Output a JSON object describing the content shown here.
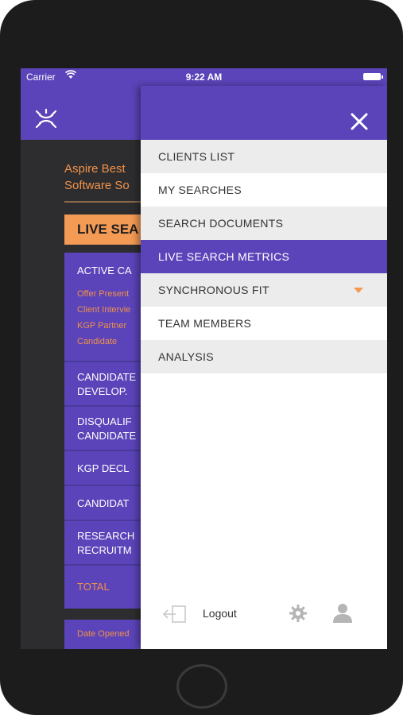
{
  "status_bar": {
    "carrier": "Carrier",
    "time": "9:22 AM"
  },
  "app": {
    "company_line1": "Aspire Best",
    "company_line2": "Software So",
    "tab_label": "LIVE SEA",
    "metrics": [
      {
        "title": "ACTIVE CA",
        "subs": [
          "Offer Present",
          "Client Intervie",
          "KGP Partner",
          "Candidate"
        ]
      },
      {
        "title_line1": "CANDIDATE",
        "title_line2": "DEVELOP."
      },
      {
        "title_line1": "DISQUALIF",
        "title_line2": "CANDIDATE"
      },
      {
        "title": "KGP DECL"
      },
      {
        "title": "CANDIDAT"
      },
      {
        "title_line1": "RESEARCH",
        "title_line2": "RECRUITM"
      },
      {
        "title": "TOTAL"
      }
    ],
    "date_label": "Date Opened"
  },
  "drawer": {
    "menu": [
      {
        "label": "CLIENTS LIST",
        "state": "grey"
      },
      {
        "label": "MY SEARCHES",
        "state": "white"
      },
      {
        "label": "SEARCH DOCUMENTS",
        "state": "grey"
      },
      {
        "label": "LIVE SEARCH METRICS",
        "state": "active"
      },
      {
        "label": "SYNCHRONOUS FIT",
        "state": "grey",
        "has_dropdown": true
      },
      {
        "label": "TEAM MEMBERS",
        "state": "white"
      },
      {
        "label": "ANALYSIS",
        "state": "grey"
      }
    ],
    "logout_label": "Logout"
  },
  "colors": {
    "primary": "#5b44b9",
    "accent": "#f39a55",
    "text_accent": "#f0914a"
  },
  "icons": [
    "wifi-icon",
    "battery-icon",
    "app-logo-icon",
    "close-icon",
    "chevron-down-icon",
    "logout-icon",
    "gear-icon",
    "user-icon"
  ]
}
